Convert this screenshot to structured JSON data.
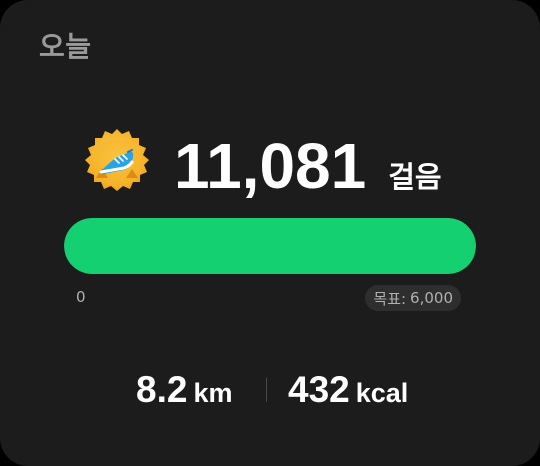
{
  "card": {
    "title": "오늘"
  },
  "steps": {
    "value": "11,081",
    "unit": "걸음",
    "badge_icon": "running-shoe-badge-icon"
  },
  "progress": {
    "fraction": 1.0,
    "min_label": "0",
    "goal_label": "목표:",
    "goal_value": "6,000",
    "fill_color": "#14d070"
  },
  "stats": {
    "distance": {
      "value": "8.2",
      "unit": "km"
    },
    "calories": {
      "value": "432",
      "unit": "kcal"
    }
  }
}
